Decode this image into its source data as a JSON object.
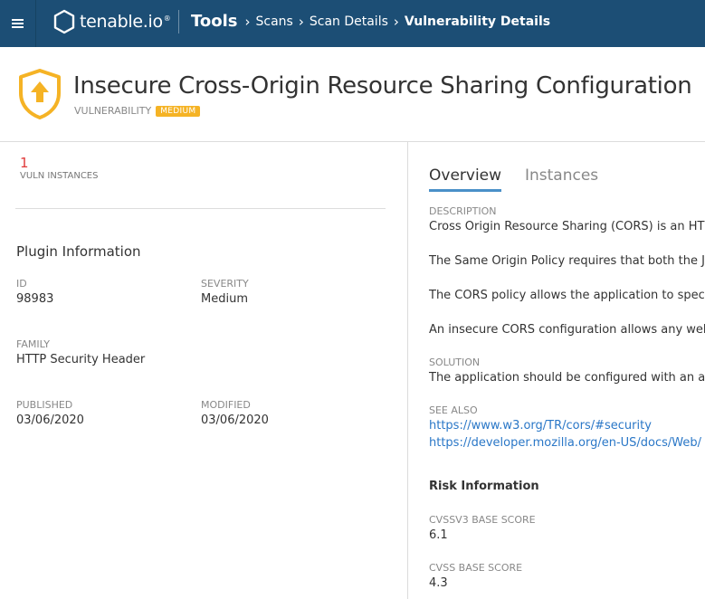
{
  "topbar": {
    "logo_text": "tenable.io",
    "logo_reg": "®",
    "breadcrumb": {
      "root": "Tools",
      "items": [
        "Scans",
        "Scan Details"
      ],
      "current": "Vulnerability Details"
    },
    "bg_color": "#1c4e75"
  },
  "header": {
    "title": "Insecure Cross-Origin Resource Sharing Configuration",
    "type_label": "VULNERABILITY",
    "severity_badge": "MEDIUM",
    "severity_color": "#f5b325"
  },
  "left": {
    "vuln_count": "1",
    "vuln_count_label": "VULN INSTANCES",
    "plugin_heading": "Plugin Information",
    "fields": {
      "id": {
        "label": "ID",
        "value": "98983"
      },
      "severity": {
        "label": "SEVERITY",
        "value": "Medium"
      },
      "family": {
        "label": "FAMILY",
        "value": "HTTP Security Header"
      },
      "published": {
        "label": "PUBLISHED",
        "value": "03/06/2020"
      },
      "modified": {
        "label": "MODIFIED",
        "value": "03/06/2020"
      }
    }
  },
  "right": {
    "tabs": [
      {
        "label": "Overview",
        "active": true
      },
      {
        "label": "Instances",
        "active": false
      }
    ],
    "description_label": "DESCRIPTION",
    "description_paragraphs": [
      "Cross Origin Resource Sharing (CORS) is an HTM",
      "The Same Origin Policy requires that both the Ja",
      "The CORS policy allows the application to speci",
      "An insecure CORS configuration allows any web"
    ],
    "solution_label": "SOLUTION",
    "solution_text": "The application should be configured with an a",
    "see_also_label": "SEE ALSO",
    "see_also_links": [
      "https://www.w3.org/TR/cors/#security",
      "https://developer.mozilla.org/en-US/docs/Web/"
    ],
    "risk_heading": "Risk Information",
    "cvssv3_label": "CVSSV3 BASE SCORE",
    "cvssv3_value": "6.1",
    "cvss_label": "CVSS BASE SCORE",
    "cvss_value": "4.3",
    "link_color": "#2a77c7",
    "accent_color": "#4a90c8"
  }
}
